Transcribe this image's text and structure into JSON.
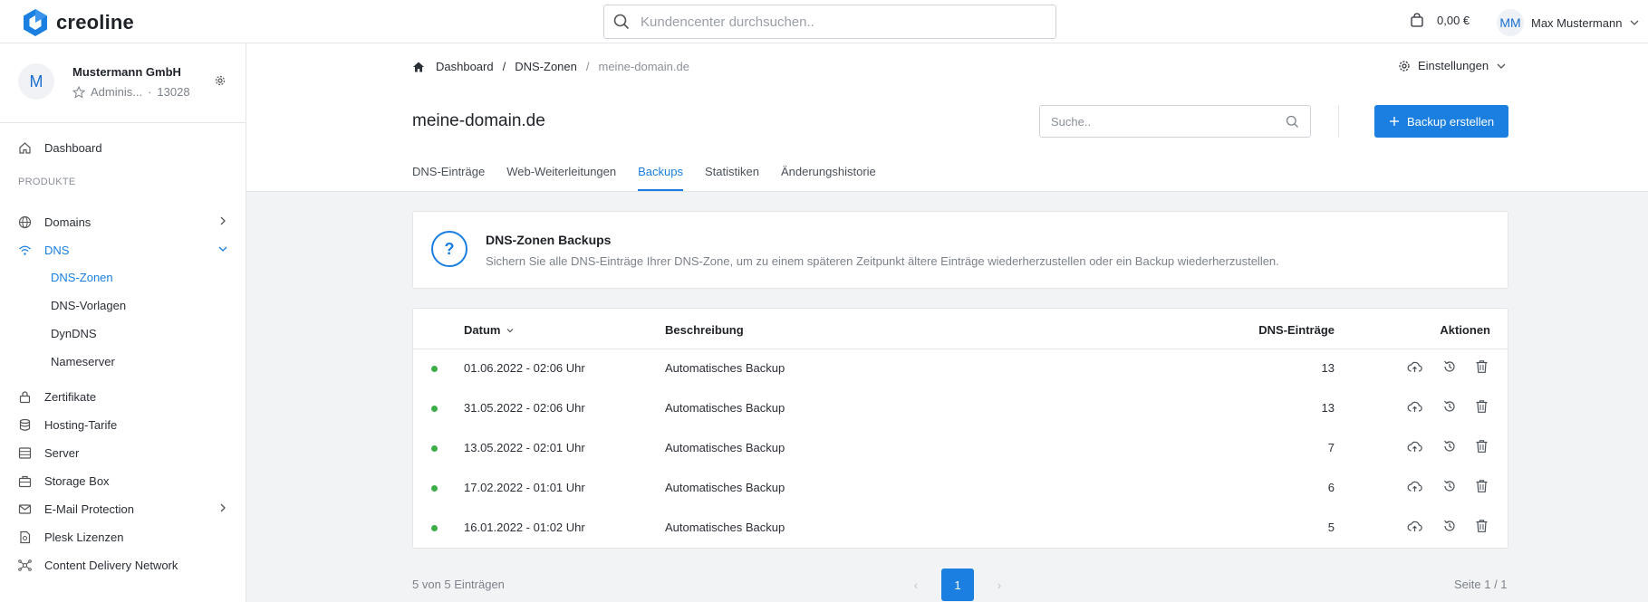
{
  "brand": {
    "name": "creoline",
    "color": "#1a7fe0"
  },
  "topbar": {
    "search_placeholder": "Kundencenter durchsuchen..",
    "cart_amount": "0,00 €",
    "user_initials": "MM",
    "user_name": "Max Mustermann"
  },
  "sidebar": {
    "account_initial": "M",
    "account_name": "Mustermann GmbH",
    "account_role": "Adminis...",
    "account_dot": "·",
    "account_number": "13028",
    "dashboard": "Dashboard",
    "section_products": "PRODUKTE",
    "items": [
      {
        "label": "Domains",
        "icon": "globe-icon"
      },
      {
        "label": "DNS",
        "icon": "wifi-icon"
      },
      {
        "label": "Zertifikate",
        "icon": "lock-icon"
      },
      {
        "label": "Hosting-Tarife",
        "icon": "database-icon"
      },
      {
        "label": "Server",
        "icon": "server-icon"
      },
      {
        "label": "Storage Box",
        "icon": "box-icon"
      },
      {
        "label": "E-Mail Protection",
        "icon": "mail-icon"
      },
      {
        "label": "Plesk Lizenzen",
        "icon": "document-icon"
      },
      {
        "label": "Content Delivery Network",
        "icon": "network-icon"
      }
    ],
    "dns_sub": [
      "DNS-Zonen",
      "DNS-Vorlagen",
      "DynDNS",
      "Nameserver"
    ]
  },
  "breadcrumb": {
    "home": "Dashboard",
    "sep": "/",
    "level2": "DNS-Zonen",
    "current": "meine-domain.de"
  },
  "settings_label": "Einstellungen",
  "page_title": "meine-domain.de",
  "search_placeholder": "Suche..",
  "create_backup_label": "Backup erstellen",
  "tabs": [
    "DNS-Einträge",
    "Web-Weiterleitungen",
    "Backups",
    "Statistiken",
    "Änderungshistorie"
  ],
  "info": {
    "icon_glyph": "?",
    "title": "DNS-Zonen Backups",
    "description": "Sichern Sie alle DNS-Einträge Ihrer DNS-Zone, um zu einem späteren Zeitpunkt ältere Einträge wiederherzustellen oder ein Backup wiederherzustellen."
  },
  "table": {
    "headers": {
      "date": "Datum",
      "description": "Beschreibung",
      "entries": "DNS-Einträge",
      "actions": "Aktionen"
    },
    "rows": [
      {
        "date": "01.06.2022 - 02:06 Uhr",
        "description": "Automatisches Backup",
        "entries": "13"
      },
      {
        "date": "31.05.2022 - 02:06 Uhr",
        "description": "Automatisches Backup",
        "entries": "13"
      },
      {
        "date": "13.05.2022 - 02:01 Uhr",
        "description": "Automatisches Backup",
        "entries": "7"
      },
      {
        "date": "17.02.2022 - 01:01 Uhr",
        "description": "Automatisches Backup",
        "entries": "6"
      },
      {
        "date": "16.01.2022 - 01:02 Uhr",
        "description": "Automatisches Backup",
        "entries": "5"
      }
    ],
    "status_color": "#3cae48"
  },
  "pagination": {
    "summary": "5 von 5 Einträgen",
    "prev": "‹",
    "current": "1",
    "next": "›",
    "page_of": "Seite 1 / 1"
  }
}
